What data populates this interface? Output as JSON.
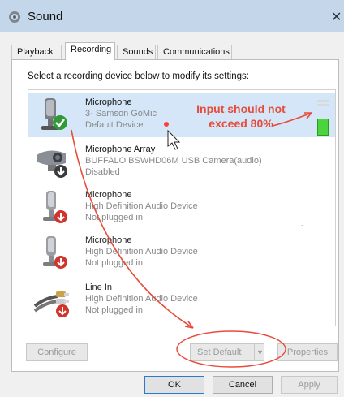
{
  "window": {
    "title": "Sound",
    "close_glyph": "✕"
  },
  "tabs": [
    {
      "label": "Playback",
      "active": false
    },
    {
      "label": "Recording",
      "active": true
    },
    {
      "label": "Sounds",
      "active": false
    },
    {
      "label": "Communications",
      "active": false
    }
  ],
  "instruction": "Select a recording device below to modify its settings:",
  "devices": [
    {
      "name": "Microphone",
      "line2": "3- Samson GoMic",
      "line3": "Default Device",
      "icon": "microphone-icon",
      "status_icon": "green-check-icon",
      "selected": true
    },
    {
      "name": "Microphone Array",
      "line2": "BUFFALO BSWHD06M USB Camera(audio)",
      "line3": "Disabled",
      "icon": "webcam-icon",
      "status_icon": "disabled-arrow-icon",
      "selected": false
    },
    {
      "name": "Microphone",
      "line2": "High Definition Audio Device",
      "line3": "Not plugged in",
      "icon": "microphone-icon",
      "status_icon": "red-down-arrow-icon",
      "selected": false
    },
    {
      "name": "Microphone",
      "line2": "High Definition Audio Device",
      "line3": "Not plugged in",
      "icon": "microphone-icon",
      "status_icon": "red-down-arrow-icon",
      "selected": false
    },
    {
      "name": "Line In",
      "line2": "High Definition Audio Device",
      "line3": "Not plugged in",
      "icon": "rca-cable-icon",
      "status_icon": "red-down-arrow-icon",
      "selected": false
    }
  ],
  "level_meter": {
    "level_fraction": 0.62,
    "color": "#4cd43c"
  },
  "annotation": {
    "line1": "Input should not",
    "line2": "exceed 80%",
    "color": "#e84b3a"
  },
  "buttons": {
    "configure": "Configure",
    "set_default": "Set Default",
    "properties": "Properties",
    "ok": "OK",
    "cancel": "Cancel",
    "apply": "Apply"
  }
}
